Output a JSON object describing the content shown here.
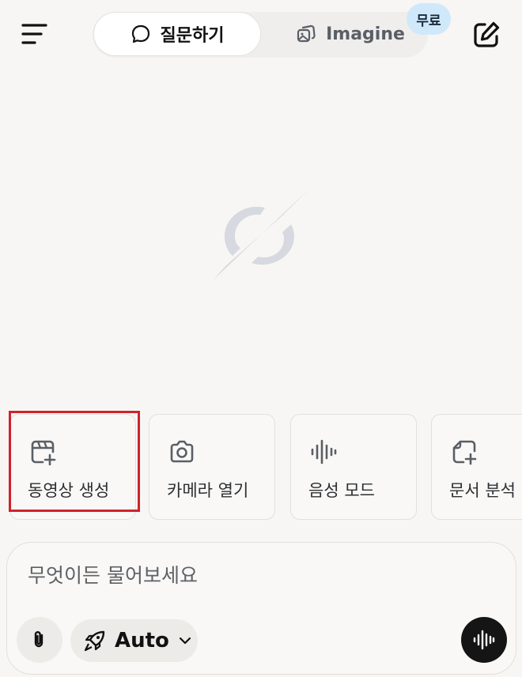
{
  "header": {
    "tabs": [
      {
        "label": "질문하기",
        "icon": "chat-bubble-icon",
        "active": true
      },
      {
        "label": "Imagine",
        "icon": "image-stack-icon",
        "active": false
      }
    ],
    "free_badge": "무료"
  },
  "quick_actions": [
    {
      "label": "동영상 생성",
      "icon": "video-create-icon",
      "highlighted": true
    },
    {
      "label": "카메라 열기",
      "icon": "camera-icon"
    },
    {
      "label": "음성 모드",
      "icon": "waveform-icon"
    },
    {
      "label": "문서 분석",
      "icon": "document-add-icon"
    }
  ],
  "composer": {
    "placeholder": "무엇이든 물어보세요",
    "model_label": "Auto"
  },
  "colors": {
    "background": "#f7f6f4",
    "highlight": "#d0222b",
    "badge": "#cfe9fb",
    "voice_button": "#151515",
    "logo": "#d6d9df"
  }
}
